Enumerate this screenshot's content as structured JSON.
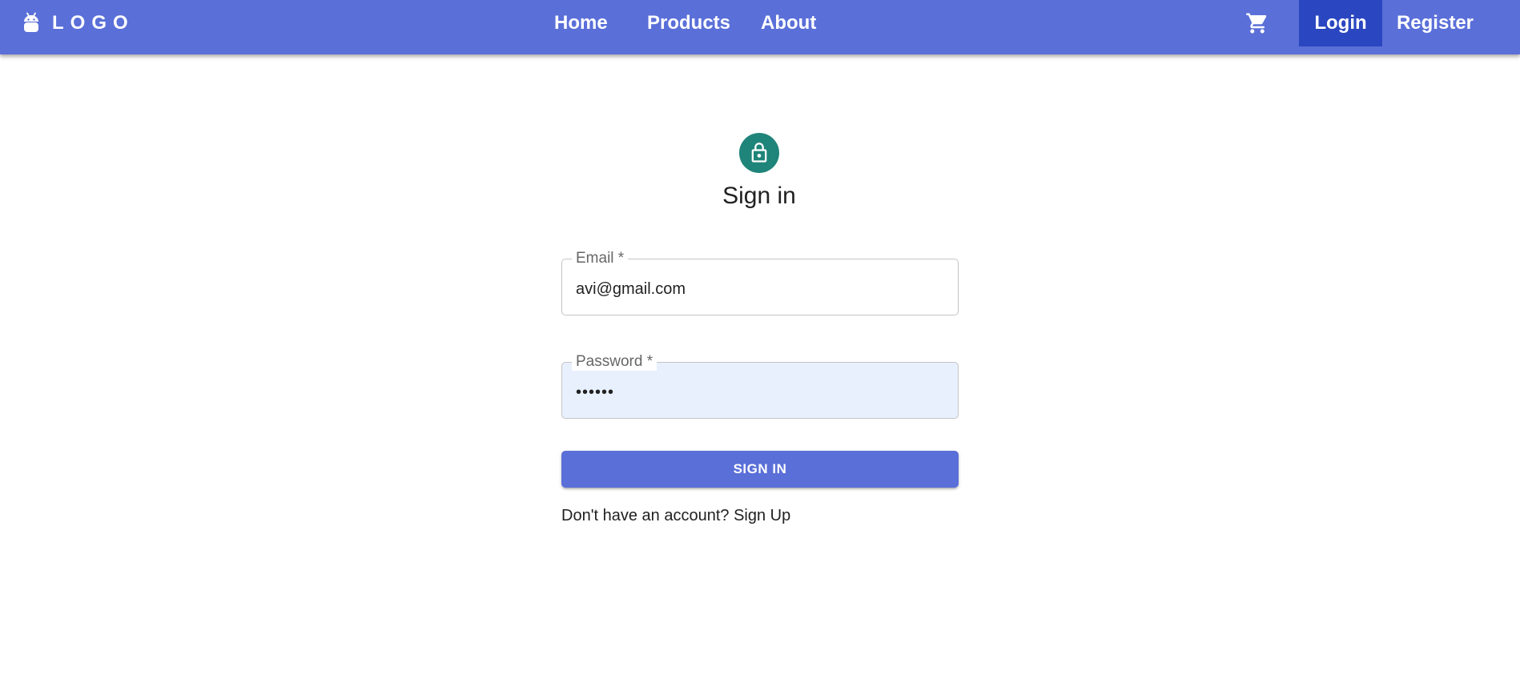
{
  "header": {
    "logo_text": "LOGO",
    "nav": {
      "home": "Home",
      "products": "Products",
      "about": "About"
    },
    "cart_icon": "shopping-cart-icon",
    "login_label": "Login",
    "register_label": "Register"
  },
  "form": {
    "icon": "lock-icon",
    "title": "Sign in",
    "email": {
      "label": "Email *",
      "value": "avi@gmail.com"
    },
    "password": {
      "label": "Password *",
      "value": "••••••"
    },
    "submit_label": "SIGN IN",
    "signup_link": "Don't have an account? Sign Up"
  },
  "colors": {
    "appbar": "#5a6fd8",
    "login_active": "#2a46c0",
    "lock_avatar": "#1f8479",
    "password_autofill_bg": "#e8f0fe",
    "button": "#5a6fd8"
  }
}
